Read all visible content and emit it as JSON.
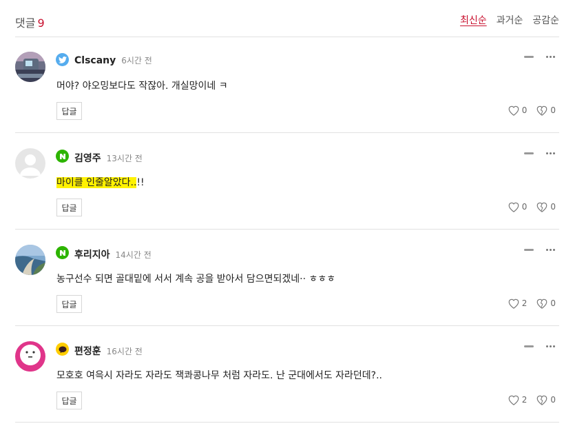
{
  "header": {
    "label": "댓글",
    "count": "9",
    "sort": [
      "최신순",
      "과거순",
      "공감순"
    ]
  },
  "reply_label": "답글",
  "comments": [
    {
      "author": "Clscany",
      "time": "6시간 전",
      "sns": "twitter",
      "text_highlight": "",
      "text": "머야? 야오밍보다도 작잖아. 개실망이네 ㅋ",
      "likes": "0",
      "dislikes": "0"
    },
    {
      "author": "김영주",
      "time": "13시간 전",
      "sns": "naver",
      "text_highlight": "마이클 인줄알았다..",
      "text": "!!",
      "likes": "0",
      "dislikes": "0"
    },
    {
      "author": "후리지아",
      "time": "14시간 전",
      "sns": "naver",
      "text_highlight": "",
      "text": "농구선수 되면 골대밑에 서서 계속 공을 받아서 담으면되겠네·· ㅎㅎㅎ",
      "likes": "2",
      "dislikes": "0"
    },
    {
      "author": "편정훈",
      "time": "16시간 전",
      "sns": "kakao",
      "text_highlight": "",
      "text": "모호호 여윽시 자라도 자라도 잭콰콩나무 처럼 자라도. 난 군대에서도 자라던데?..",
      "likes": "2",
      "dislikes": "0"
    }
  ],
  "colors": {
    "accent": "#c8102e",
    "twitter": "#55acee",
    "naver": "#2db400",
    "kakao": "#ffcd00",
    "highlight": "#fff200",
    "avatar_pink": "#e0358a"
  }
}
